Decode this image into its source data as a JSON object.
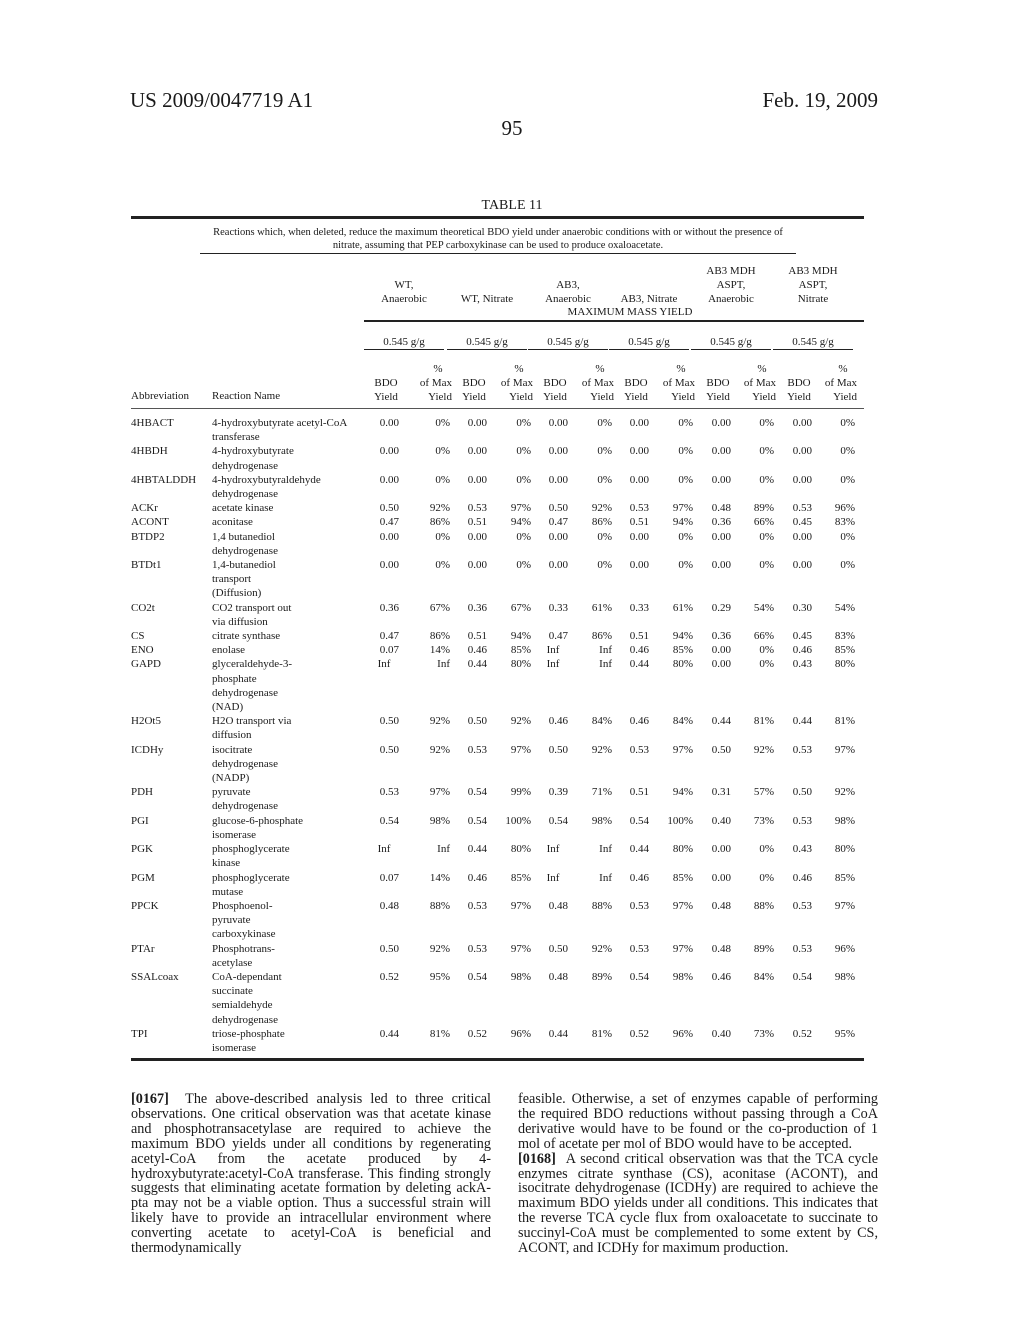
{
  "header": {
    "patent_number": "US 2009/0047719 A1",
    "date": "Feb. 19, 2009",
    "page_number": "95"
  },
  "table": {
    "title": "TABLE 11",
    "caption": "Reactions which, when deleted, reduce the maximum theoretical BDO yield under anaerobic conditions with or without the presence of nitrate, assuming that PEP carboxykinase can be used to produce oxaloacetate.",
    "conditions": [
      {
        "line1": "",
        "line2": "WT,",
        "line3": "Anaerobic"
      },
      {
        "line1": "",
        "line2": "",
        "line3": "WT, Nitrate"
      },
      {
        "line1": "",
        "line2": "AB3,",
        "line3": "Anaerobic"
      },
      {
        "line1": "",
        "line2": "",
        "line3": "AB3, Nitrate"
      },
      {
        "line1": "AB3 MDH",
        "line2": "ASPT,",
        "line3": "Anaerobic"
      },
      {
        "line1": "AB3 MDH",
        "line2": "ASPT,",
        "line3": "Nitrate"
      }
    ],
    "group_label": "MAXIMUM MASS YIELD",
    "max_yields": [
      "0.545 g/g",
      "0.545 g/g",
      "0.545 g/g",
      "0.545 g/g",
      "0.545 g/g",
      "0.545 g/g"
    ],
    "sub_headers": {
      "bdo": [
        "BDO",
        "Yield"
      ],
      "pct": [
        "%",
        "of Max",
        "Yield"
      ]
    },
    "col_abbreviation": "Abbreviation",
    "col_reaction_name": "Reaction Name",
    "rows": [
      {
        "abbr": "4HBACT",
        "name": [
          "4-hydroxybutyrate acetyl-CoA",
          "transferase"
        ],
        "values": [
          "0.00",
          "0%",
          "0.00",
          "0%",
          "0.00",
          "0%",
          "0.00",
          "0%",
          "0.00",
          "0%",
          "0.00",
          "0%"
        ]
      },
      {
        "abbr": "4HBDH",
        "name": [
          "4-hydroxybutyrate",
          "dehydrogenase"
        ],
        "values": [
          "0.00",
          "0%",
          "0.00",
          "0%",
          "0.00",
          "0%",
          "0.00",
          "0%",
          "0.00",
          "0%",
          "0.00",
          "0%"
        ]
      },
      {
        "abbr": "4HBTALDDH",
        "name": [
          "4-hydroxybutyraldehyde",
          "dehydrogenase"
        ],
        "values": [
          "0.00",
          "0%",
          "0.00",
          "0%",
          "0.00",
          "0%",
          "0.00",
          "0%",
          "0.00",
          "0%",
          "0.00",
          "0%"
        ]
      },
      {
        "abbr": "ACKr",
        "name": [
          "acetate kinase"
        ],
        "values": [
          "0.50",
          "92%",
          "0.53",
          "97%",
          "0.50",
          "92%",
          "0.53",
          "97%",
          "0.48",
          "89%",
          "0.53",
          "96%"
        ]
      },
      {
        "abbr": "ACONT",
        "name": [
          "aconitase"
        ],
        "values": [
          "0.47",
          "86%",
          "0.51",
          "94%",
          "0.47",
          "86%",
          "0.51",
          "94%",
          "0.36",
          "66%",
          "0.45",
          "83%"
        ]
      },
      {
        "abbr": "BTDP2",
        "name": [
          "1,4 butanediol",
          "dehydrogenase"
        ],
        "values": [
          "0.00",
          "0%",
          "0.00",
          "0%",
          "0.00",
          "0%",
          "0.00",
          "0%",
          "0.00",
          "0%",
          "0.00",
          "0%"
        ]
      },
      {
        "abbr": "BTDt1",
        "name": [
          "1,4-butanediol",
          "transport",
          "(Diffusion)"
        ],
        "values": [
          "0.00",
          "0%",
          "0.00",
          "0%",
          "0.00",
          "0%",
          "0.00",
          "0%",
          "0.00",
          "0%",
          "0.00",
          "0%"
        ]
      },
      {
        "abbr": "CO2t",
        "name": [
          "CO2 transport out",
          "via diffusion"
        ],
        "values": [
          "0.36",
          "67%",
          "0.36",
          "67%",
          "0.33",
          "61%",
          "0.33",
          "61%",
          "0.29",
          "54%",
          "0.30",
          "54%"
        ]
      },
      {
        "abbr": "CS",
        "name": [
          "citrate synthase"
        ],
        "values": [
          "0.47",
          "86%",
          "0.51",
          "94%",
          "0.47",
          "86%",
          "0.51",
          "94%",
          "0.36",
          "66%",
          "0.45",
          "83%"
        ]
      },
      {
        "abbr": "ENO",
        "name": [
          "enolase"
        ],
        "values": [
          "0.07",
          "14%",
          "0.46",
          "85%",
          "Inf",
          "Inf",
          "0.46",
          "85%",
          "0.00",
          "0%",
          "0.46",
          "85%"
        ]
      },
      {
        "abbr": "GAPD",
        "name": [
          "glyceraldehyde-3-",
          "phosphate",
          "dehydrogenase",
          "(NAD)"
        ],
        "values": [
          "Inf",
          "Inf",
          "0.44",
          "80%",
          "Inf",
          "Inf",
          "0.44",
          "80%",
          "0.00",
          "0%",
          "0.43",
          "80%"
        ]
      },
      {
        "abbr": "H2Ot5",
        "name": [
          "H2O transport via",
          "diffusion"
        ],
        "values": [
          "0.50",
          "92%",
          "0.50",
          "92%",
          "0.46",
          "84%",
          "0.46",
          "84%",
          "0.44",
          "81%",
          "0.44",
          "81%"
        ]
      },
      {
        "abbr": "ICDHy",
        "name": [
          "isocitrate",
          "dehydrogenase",
          "(NADP)"
        ],
        "values": [
          "0.50",
          "92%",
          "0.53",
          "97%",
          "0.50",
          "92%",
          "0.53",
          "97%",
          "0.50",
          "92%",
          "0.53",
          "97%"
        ]
      },
      {
        "abbr": "PDH",
        "name": [
          "pyruvate",
          "dehydrogenase"
        ],
        "values": [
          "0.53",
          "97%",
          "0.54",
          "99%",
          "0.39",
          "71%",
          "0.51",
          "94%",
          "0.31",
          "57%",
          "0.50",
          "92%"
        ]
      },
      {
        "abbr": "PGI",
        "name": [
          "glucose-6-phosphate",
          "isomerase"
        ],
        "values": [
          "0.54",
          "98%",
          "0.54",
          "100%",
          "0.54",
          "98%",
          "0.54",
          "100%",
          "0.40",
          "73%",
          "0.53",
          "98%"
        ]
      },
      {
        "abbr": "PGK",
        "name": [
          "phosphoglycerate",
          "kinase"
        ],
        "values": [
          "Inf",
          "Inf",
          "0.44",
          "80%",
          "Inf",
          "Inf",
          "0.44",
          "80%",
          "0.00",
          "0%",
          "0.43",
          "80%"
        ]
      },
      {
        "abbr": "PGM",
        "name": [
          "phosphoglycerate",
          "mutase"
        ],
        "values": [
          "0.07",
          "14%",
          "0.46",
          "85%",
          "Inf",
          "Inf",
          "0.46",
          "85%",
          "0.00",
          "0%",
          "0.46",
          "85%"
        ]
      },
      {
        "abbr": "PPCK",
        "name": [
          "Phosphoenol-",
          "pyruvate",
          "carboxykinase"
        ],
        "values": [
          "0.48",
          "88%",
          "0.53",
          "97%",
          "0.48",
          "88%",
          "0.53",
          "97%",
          "0.48",
          "88%",
          "0.53",
          "97%"
        ]
      },
      {
        "abbr": "PTAr",
        "name": [
          "Phosphotrans-",
          "acetylase"
        ],
        "values": [
          "0.50",
          "92%",
          "0.53",
          "97%",
          "0.50",
          "92%",
          "0.53",
          "97%",
          "0.48",
          "89%",
          "0.53",
          "96%"
        ]
      },
      {
        "abbr": "SSALcoax",
        "name": [
          "CoA-dependant",
          "succinate",
          "semialdehyde",
          "dehydrogenase"
        ],
        "values": [
          "0.52",
          "95%",
          "0.54",
          "98%",
          "0.48",
          "89%",
          "0.54",
          "98%",
          "0.46",
          "84%",
          "0.54",
          "98%"
        ]
      },
      {
        "abbr": "TPI",
        "name": [
          "triose-phosphate",
          "isomerase"
        ],
        "values": [
          "0.44",
          "81%",
          "0.52",
          "96%",
          "0.44",
          "81%",
          "0.52",
          "96%",
          "0.40",
          "73%",
          "0.52",
          "95%"
        ]
      }
    ]
  },
  "paragraphs": {
    "p0167": {
      "number": "[0167]",
      "text_left": "The above-described analysis led to three critical observations. One critical observation was that acetate kinase and phosphotransacetylase are required to achieve the maximum BDO yields under all conditions by regenerating acetyl-CoA from the acetate produced by 4-hydroxybutyrate:acetyl-CoA transferase. This finding strongly suggests that eliminating acetate formation by deleting ackA-pta may not be a viable option. Thus a successful strain will likely have to provide an intracellular environment where converting acetate to acetyl-CoA is beneficial and thermodynamically",
      "text_right": "feasible. Otherwise, a set of enzymes capable of performing the required BDO reductions without passing through a CoA derivative would have to be found or the co-production of 1 mol of acetate per mol of BDO would have to be accepted."
    },
    "p0168": {
      "number": "[0168]",
      "text": "A second critical observation was that the TCA cycle enzymes citrate synthase (CS), aconitase (ACONT), and isocitrate dehydrogenase (ICDHy) are required to achieve the maximum BDO yields under all conditions. This indicates that the reverse TCA cycle flux from oxaloacetate to succinate to succinyl-CoA must be complemented to some extent by CS, ACONT, and ICDHy for maximum production."
    }
  }
}
